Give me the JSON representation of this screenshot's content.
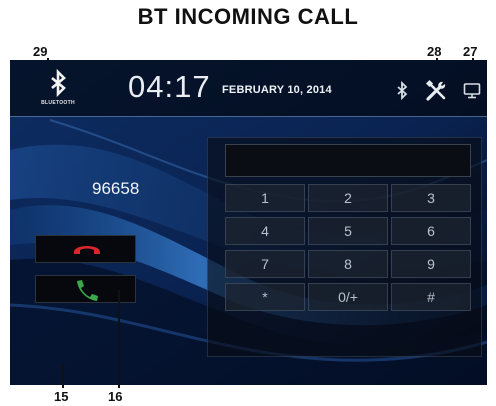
{
  "heading": "BT INCOMING CALL",
  "callouts": {
    "c29": "29",
    "c28": "28",
    "c27": "27",
    "c15": "15",
    "c16": "16"
  },
  "status_bar": {
    "bluetooth_label": "BLUETOOTH",
    "time": "04:17",
    "date": "FEBRUARY 10, 2014",
    "icons": [
      "bluetooth-icon",
      "settings-tools-icon",
      "display-icon"
    ]
  },
  "caller_number": "96658",
  "call_buttons": [
    {
      "name": "reject-call",
      "icon": "hang-up-icon",
      "color": "#d8262b"
    },
    {
      "name": "answer-call",
      "icon": "phone-answer-icon",
      "color": "#3aa84a"
    }
  ],
  "keypad": {
    "display_value": "",
    "keys": [
      "1",
      "2",
      "3",
      "4",
      "5",
      "6",
      "7",
      "8",
      "9",
      "*",
      "0/+",
      "#"
    ]
  }
}
